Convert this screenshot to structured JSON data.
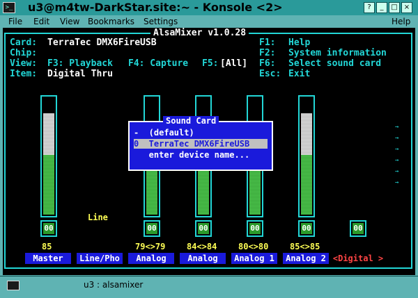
{
  "window": {
    "title": "u3@m4tw-DarkStar.site:~ - Konsole <2>",
    "buttons": [
      "?",
      "_",
      "□",
      "×"
    ]
  },
  "menubar": {
    "items": [
      "File",
      "Edit",
      "View",
      "Bookmarks",
      "Settings"
    ],
    "help": "Help"
  },
  "mixer": {
    "title": "AlsaMixer v1.0.28",
    "card_label": "Card:",
    "card_value": "TerraTec DMX6FireUSB",
    "chip_label": "Chip:",
    "view_label": "View:",
    "view_playback": "F3: Playback",
    "view_capture": "F4: Capture",
    "view_all_key": "F5:",
    "view_all": "[All]",
    "item_label": "Item:",
    "item_value": "Digital Thru",
    "keys": [
      {
        "key": "F1:",
        "action": "Help"
      },
      {
        "key": "F2:",
        "action": "System information"
      },
      {
        "key": "F6:",
        "action": "Select sound card"
      },
      {
        "key": "Esc:",
        "action": "Exit"
      }
    ]
  },
  "channels": [
    {
      "name": "Master",
      "volume": "85",
      "mute": "00",
      "level_white": 0.85,
      "level_green": 0.55
    },
    {
      "name": "Line/Pho",
      "volume": "",
      "mute": "",
      "extra": "Line"
    },
    {
      "name": "Analog",
      "volume": "79<>79",
      "mute": "00",
      "level_green": 0.52
    },
    {
      "name": "Analog",
      "volume": "84<>84",
      "mute": "00",
      "level_green": 0.55
    },
    {
      "name": "Analog 1",
      "volume": "80<>80",
      "mute": "00",
      "level_green": 0.53
    },
    {
      "name": "Analog 2",
      "volume": "85<>85",
      "mute": "00",
      "level_white": 0.85,
      "level_green": 0.55
    },
    {
      "name": "<Digital >",
      "volume": "",
      "mute": "00",
      "selected": true
    }
  ],
  "dialog": {
    "title": "Sound Card",
    "items": [
      "-  (default)",
      "0  TerraTec DMX6FireUSB",
      "   enter device name..."
    ],
    "selected_index": 1
  },
  "taskbar": {
    "task": "u3 : alsamixer"
  },
  "colors": {
    "frame": "#22d7d7",
    "label": "#22d7d7",
    "value": "#ffffff",
    "highlight": "#ffff55",
    "channel_bg": "#1a1adb",
    "selected_bg": "#d32a2a",
    "green": "#4dc14d"
  }
}
